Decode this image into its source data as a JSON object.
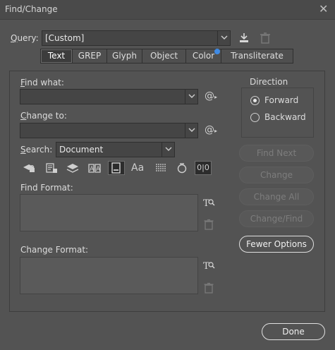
{
  "window": {
    "title": "Find/Change",
    "close_glyph": "✕"
  },
  "query": {
    "label_prefix": "Q",
    "label_rest": "uery:",
    "value": "[Custom]"
  },
  "tabs": [
    {
      "label": "Text",
      "active": true
    },
    {
      "label": "GREP"
    },
    {
      "label": "Glyph"
    },
    {
      "label": "Object"
    },
    {
      "label": "Color",
      "badge": true
    },
    {
      "label": "Transliterate"
    }
  ],
  "find_what": {
    "label_prefix": "F",
    "label_rest": "ind what:",
    "value": ""
  },
  "change_to": {
    "label_prefix": "C",
    "label_rest": "hange to:",
    "value": ""
  },
  "search": {
    "label_prefix": "S",
    "label_rest": "earch:",
    "value": "Document"
  },
  "find_format": {
    "label": "Find Format:"
  },
  "change_format": {
    "label": "Change Format:"
  },
  "direction": {
    "label": "Direction",
    "options": [
      {
        "label": "Forward",
        "selected": true
      },
      {
        "label": "Backward",
        "selected": false
      }
    ]
  },
  "buttons": {
    "find_next": "Find Next",
    "change": "Change",
    "change_all": "Change All",
    "change_find": "Change/Find",
    "fewer_options": "Fewer Options",
    "done": "Done"
  },
  "special_char_glyph": "@",
  "icons": {
    "save_query": "save-icon",
    "delete_query": "trash-icon",
    "options_row": [
      "lock-layers-icon",
      "lock-stories-icon",
      "hidden-layers-icon",
      "master-pages-icon",
      "footnotes-icon",
      "case-sensitive-icon",
      "whole-word-icon",
      "kana-sensitive-icon",
      "width-sensitive-icon"
    ]
  },
  "options_row_text": {
    "case": "Aa",
    "width": "0|0"
  },
  "colors": {
    "background": "#535353",
    "accent": "#3f8be6"
  }
}
